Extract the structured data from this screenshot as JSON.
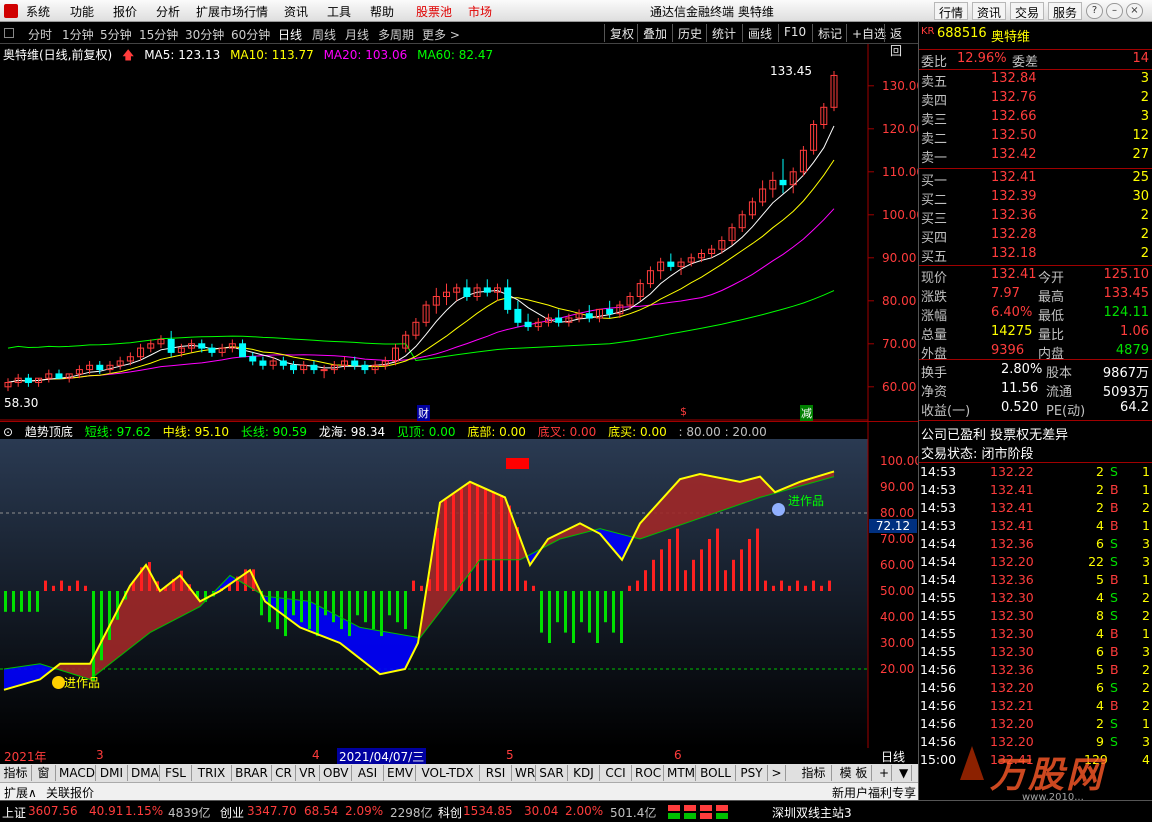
{
  "menubar": {
    "items": [
      "系统",
      "功能",
      "报价",
      "分析",
      "扩展市场行情",
      "资讯",
      "工具",
      "帮助"
    ],
    "stock_pool": "股票池",
    "market": "市场",
    "title": "通达信金融终端 奥特维",
    "right_buttons": [
      "行情",
      "资讯",
      "交易",
      "服务"
    ]
  },
  "toolbar": {
    "periods": [
      "分时",
      "1分钟",
      "5分钟",
      "15分钟",
      "30分钟",
      "60分钟",
      "日线",
      "周线",
      "月线",
      "多周期",
      "更多 >"
    ],
    "active": "日线",
    "right_buttons": [
      "复权",
      "叠加",
      "历史",
      "统计",
      "画线",
      "F10",
      "标记",
      "+自选",
      "返回"
    ]
  },
  "chart_header": {
    "name": "奥特维(日线,前复权)",
    "ma5": "MA5: 123.13",
    "ma10": "MA10: 113.77",
    "ma20": "MA20: 103.06",
    "ma60": "MA60: 82.47",
    "high_mark": "133.45",
    "low_mark": "58.30",
    "markers": [
      "财",
      "$",
      "减"
    ]
  },
  "indicator_header": {
    "name": "趋势顶底",
    "short": "短线: 97.62",
    "mid": "中线: 95.10",
    "long": "长线: 90.59",
    "longhai": "龙海: 98.34",
    "jianding": "见顶: 0.00",
    "dibu": "底部: 0.00",
    "dicha": "底叉: 0.00",
    "dimai": "底买: 0.00",
    "levels": ": 80.00  : 20.00",
    "current_value": "72.12",
    "labels": [
      "进作品",
      "进作品"
    ]
  },
  "date_bar": {
    "items": [
      "2021年",
      "3",
      "4",
      "2021/04/07/三",
      "5",
      "6"
    ]
  },
  "period_label": "日线",
  "tabs": [
    "指标A",
    "窗口",
    "MACD",
    "DMI",
    "DMA",
    "FSL",
    "TRIX",
    "BRAR",
    "CR",
    "VR",
    "OBV",
    "ASI",
    "EMV",
    "VOL-TDX",
    "RSI",
    "WR",
    "SAR",
    "KDJ",
    "CCI",
    "ROC",
    "MTM",
    "BOLL",
    "PSY",
    ">"
  ],
  "tabs_right": [
    "指标B",
    "模 板",
    "+",
    "▼"
  ],
  "ext_bar": {
    "left": "扩展∧",
    "related": "关联报价",
    "right": "新用户福利专享",
    "pen": "笔"
  },
  "status": {
    "sh_label": "上证",
    "sh_val": "3607.56",
    "sh_chg": "40.91",
    "sh_pct": "1.15%",
    "sh_amt": "4839亿",
    "cy_label": "创业",
    "cy_val": "3347.70",
    "cy_chg": "68.54",
    "cy_pct": "2.09%",
    "cy_amt": "2298亿",
    "kc_label": "科创",
    "kc_val": "1534.85",
    "kc_chg": "30.04",
    "kc_pct": "2.00%",
    "kc_amt": "501.4亿",
    "server": "深圳双线主站3"
  },
  "quote": {
    "code": "688516",
    "name": "奥特维",
    "weibi_label": "委比",
    "weibi": "12.96%",
    "weicha_label": "委差",
    "weicha": "14",
    "asks": [
      {
        "l": "卖五",
        "p": "132.84",
        "v": "3"
      },
      {
        "l": "卖四",
        "p": "132.76",
        "v": "2"
      },
      {
        "l": "卖三",
        "p": "132.66",
        "v": "3"
      },
      {
        "l": "卖二",
        "p": "132.50",
        "v": "12"
      },
      {
        "l": "卖一",
        "p": "132.42",
        "v": "27"
      }
    ],
    "bids": [
      {
        "l": "买一",
        "p": "132.41",
        "v": "25"
      },
      {
        "l": "买二",
        "p": "132.39",
        "v": "30"
      },
      {
        "l": "买三",
        "p": "132.36",
        "v": "2"
      },
      {
        "l": "买四",
        "p": "132.28",
        "v": "2"
      },
      {
        "l": "买五",
        "p": "132.18",
        "v": "2"
      }
    ],
    "stats": [
      {
        "l1": "现价",
        "v1": "132.41",
        "l2": "今开",
        "v2": "125.10"
      },
      {
        "l1": "涨跌",
        "v1": "7.97",
        "l2": "最高",
        "v2": "133.45"
      },
      {
        "l1": "涨幅",
        "v1": "6.40%",
        "l2": "最低",
        "v2": "124.11"
      },
      {
        "l1": "总量",
        "v1": "14275",
        "l2": "量比",
        "v2": "1.06"
      },
      {
        "l1": "外盘",
        "v1": "9396",
        "l2": "内盘",
        "v2": "4879"
      }
    ],
    "stats2": [
      {
        "l1": "换手",
        "v1": "2.80%",
        "l2": "股本",
        "v2": "9867万"
      },
      {
        "l1": "净资",
        "v1": "11.56",
        "l2": "流通",
        "v2": "5093万"
      },
      {
        "l1": "收益(一)",
        "v1": "0.520",
        "l2": "PE(动)",
        "v2": "64.2"
      }
    ],
    "notice1": "公司已盈利 投票权无差异",
    "notice2": "交易状态: 闭市阶段"
  },
  "ticks": [
    {
      "t": "14:53",
      "p": "132.22",
      "v": "2",
      "d": "S",
      "n": "1"
    },
    {
      "t": "14:53",
      "p": "132.41",
      "v": "2",
      "d": "B",
      "n": "1"
    },
    {
      "t": "14:53",
      "p": "132.41",
      "v": "2",
      "d": "B",
      "n": "2"
    },
    {
      "t": "14:53",
      "p": "132.41",
      "v": "4",
      "d": "B",
      "n": "1"
    },
    {
      "t": "14:54",
      "p": "132.36",
      "v": "6",
      "d": "S",
      "n": "3"
    },
    {
      "t": "14:54",
      "p": "132.20",
      "v": "22",
      "d": "S",
      "n": "3"
    },
    {
      "t": "14:54",
      "p": "132.36",
      "v": "5",
      "d": "B",
      "n": "1"
    },
    {
      "t": "14:55",
      "p": "132.30",
      "v": "4",
      "d": "S",
      "n": "2"
    },
    {
      "t": "14:55",
      "p": "132.30",
      "v": "8",
      "d": "S",
      "n": "2"
    },
    {
      "t": "14:55",
      "p": "132.30",
      "v": "4",
      "d": "B",
      "n": "1"
    },
    {
      "t": "14:55",
      "p": "132.30",
      "v": "6",
      "d": "B",
      "n": "3"
    },
    {
      "t": "14:56",
      "p": "132.36",
      "v": "5",
      "d": "B",
      "n": "2"
    },
    {
      "t": "14:56",
      "p": "132.20",
      "v": "6",
      "d": "S",
      "n": "2"
    },
    {
      "t": "14:56",
      "p": "132.21",
      "v": "4",
      "d": "B",
      "n": "2"
    },
    {
      "t": "14:56",
      "p": "132.20",
      "v": "2",
      "d": "S",
      "n": "1"
    },
    {
      "t": "14:56",
      "p": "132.20",
      "v": "9",
      "d": "S",
      "n": "3"
    },
    {
      "t": "15:00",
      "p": "132.41",
      "v": "129",
      "d": "",
      "n": "4"
    }
  ],
  "watermark": {
    "text": "万股网",
    "url": "www.2010..."
  },
  "colors": {
    "up": "#ff3c3c",
    "down": "#00ffff",
    "ma5": "#ffffff",
    "ma10": "#ffff00",
    "ma20": "#ff00ff",
    "ma60": "#00ff00"
  },
  "chart_data": {
    "type": "candlestick",
    "y_ticks": [
      60,
      70,
      80,
      90,
      100,
      110,
      120,
      130
    ],
    "ylim": [
      56,
      136
    ],
    "ohlc": [
      [
        60,
        62,
        59,
        61
      ],
      [
        61,
        63,
        60,
        62
      ],
      [
        62,
        63,
        60,
        61
      ],
      [
        61,
        62,
        60,
        62
      ],
      [
        62,
        64,
        61,
        63
      ],
      [
        63,
        64,
        62,
        62
      ],
      [
        62,
        63,
        61,
        63
      ],
      [
        63,
        65,
        62,
        64
      ],
      [
        64,
        66,
        63,
        65
      ],
      [
        65,
        66,
        63,
        64
      ],
      [
        64,
        66,
        63,
        65
      ],
      [
        65,
        67,
        64,
        66
      ],
      [
        66,
        68,
        65,
        67
      ],
      [
        67,
        70,
        66,
        69
      ],
      [
        69,
        71,
        68,
        70
      ],
      [
        70,
        72,
        69,
        71
      ],
      [
        71,
        73,
        67,
        68
      ],
      [
        68,
        70,
        67,
        69
      ],
      [
        69,
        71,
        68,
        70
      ],
      [
        70,
        71,
        68,
        69
      ],
      [
        69,
        70,
        67,
        68
      ],
      [
        68,
        70,
        67,
        69
      ],
      [
        69,
        71,
        68,
        70
      ],
      [
        70,
        71,
        67,
        67
      ],
      [
        67,
        68,
        65,
        66
      ],
      [
        66,
        67,
        64,
        65
      ],
      [
        65,
        67,
        64,
        66
      ],
      [
        66,
        67,
        64,
        65
      ],
      [
        65,
        66,
        63,
        64
      ],
      [
        64,
        66,
        63,
        65
      ],
      [
        65,
        66,
        63,
        64
      ],
      [
        64,
        65,
        62,
        64
      ],
      [
        64,
        66,
        63,
        65
      ],
      [
        65,
        67,
        64,
        66
      ],
      [
        66,
        67,
        64,
        65
      ],
      [
        65,
        66,
        63,
        64
      ],
      [
        64,
        66,
        63,
        65
      ],
      [
        65,
        67,
        64,
        66
      ],
      [
        66,
        70,
        65,
        69
      ],
      [
        69,
        73,
        68,
        72
      ],
      [
        72,
        76,
        71,
        75
      ],
      [
        75,
        80,
        74,
        79
      ],
      [
        79,
        83,
        77,
        81
      ],
      [
        81,
        84,
        79,
        82
      ],
      [
        82,
        84,
        80,
        83
      ],
      [
        83,
        85,
        80,
        81
      ],
      [
        81,
        84,
        80,
        83
      ],
      [
        83,
        85,
        81,
        82
      ],
      [
        82,
        84,
        80,
        83
      ],
      [
        83,
        85,
        77,
        78
      ],
      [
        78,
        80,
        74,
        75
      ],
      [
        75,
        77,
        73,
        74
      ],
      [
        74,
        76,
        73,
        75
      ],
      [
        75,
        77,
        74,
        76
      ],
      [
        76,
        78,
        74,
        75
      ],
      [
        75,
        77,
        74,
        76
      ],
      [
        76,
        78,
        75,
        77
      ],
      [
        77,
        79,
        75,
        76
      ],
      [
        76,
        78,
        75,
        78
      ],
      [
        78,
        80,
        76,
        77
      ],
      [
        77,
        80,
        76,
        79
      ],
      [
        79,
        82,
        78,
        81
      ],
      [
        81,
        85,
        80,
        84
      ],
      [
        84,
        88,
        83,
        87
      ],
      [
        87,
        90,
        85,
        89
      ],
      [
        89,
        91,
        87,
        88
      ],
      [
        88,
        90,
        86,
        89
      ],
      [
        89,
        91,
        88,
        90
      ],
      [
        90,
        92,
        89,
        91
      ],
      [
        91,
        93,
        90,
        92
      ],
      [
        92,
        95,
        91,
        94
      ],
      [
        94,
        98,
        93,
        97
      ],
      [
        97,
        101,
        96,
        100
      ],
      [
        100,
        104,
        99,
        103
      ],
      [
        103,
        108,
        102,
        106
      ],
      [
        106,
        110,
        104,
        108
      ],
      [
        108,
        113,
        105,
        107
      ],
      [
        107,
        111,
        105,
        110
      ],
      [
        110,
        116,
        109,
        115
      ],
      [
        115,
        122,
        114,
        121
      ],
      [
        121,
        126,
        120,
        125
      ],
      [
        125,
        133.45,
        124.11,
        132.41
      ]
    ],
    "labels": {
      "high": "133.45",
      "low": "58.30"
    }
  }
}
